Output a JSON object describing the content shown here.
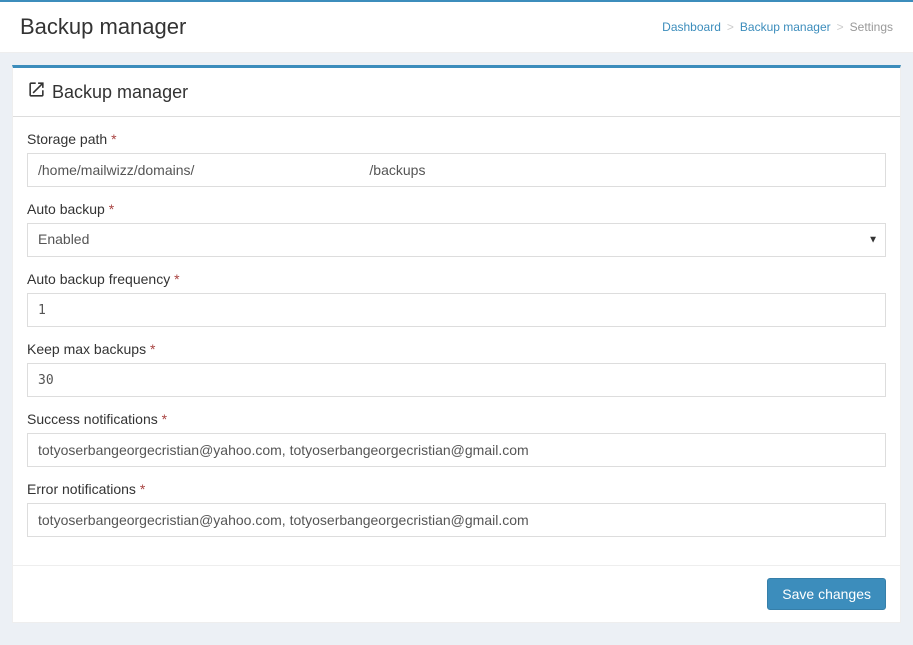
{
  "header": {
    "title": "Backup manager"
  },
  "breadcrumb": {
    "dashboard": "Dashboard",
    "backup_manager": "Backup manager",
    "settings": "Settings"
  },
  "panel": {
    "title": "Backup manager"
  },
  "form": {
    "storage_path": {
      "label": "Storage path",
      "value": "/home/mailwizz/domains/                                             /backups"
    },
    "auto_backup": {
      "label": "Auto backup",
      "value": "Enabled"
    },
    "auto_backup_frequency": {
      "label": "Auto backup frequency",
      "value": "1"
    },
    "keep_max_backups": {
      "label": "Keep max backups",
      "value": "30"
    },
    "success_notifications": {
      "label": "Success notifications",
      "value": "totyoserbangeorgecristian@yahoo.com, totyoserbangeorgecristian@gmail.com"
    },
    "error_notifications": {
      "label": "Error notifications",
      "value": "totyoserbangeorgecristian@yahoo.com, totyoserbangeorgecristian@gmail.com"
    }
  },
  "actions": {
    "save": "Save changes"
  }
}
